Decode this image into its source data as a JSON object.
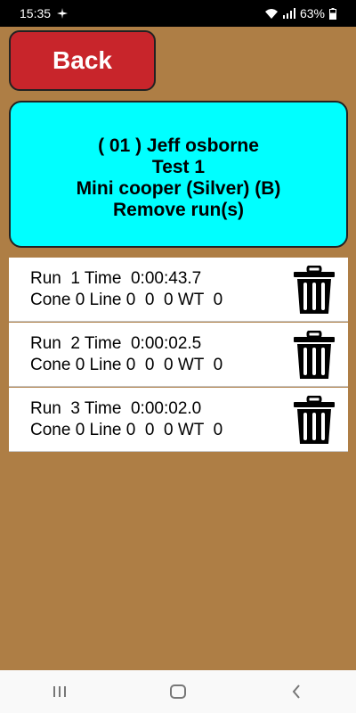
{
  "status_bar": {
    "time": "15:35",
    "battery": "63%"
  },
  "back_button": {
    "label": "Back"
  },
  "info": {
    "driver": "( 01 ) Jeff osborne",
    "test": "Test  1",
    "car": "Mini cooper (Silver) (B)",
    "action": "Remove run(s)"
  },
  "runs": [
    {
      "line1": "Run  1 Time  0:00:43.7",
      "line2": "Cone 0 Line 0  0  0 WT  0"
    },
    {
      "line1": "Run  2 Time  0:00:02.5",
      "line2": "Cone 0 Line 0  0  0 WT  0"
    },
    {
      "line1": "Run  3 Time  0:00:02.0",
      "line2": "Cone 0 Line 0  0  0 WT  0"
    }
  ],
  "colors": {
    "background": "#ae7e45",
    "back_button": "#c8252b",
    "info_card": "#00ffff"
  },
  "icons": {
    "status_left": "airplane-icon",
    "status_right": [
      "wifi-icon",
      "signal-icon",
      "battery-icon"
    ],
    "row_action": "trash-icon",
    "nav": [
      "recents-icon",
      "home-icon",
      "back-icon"
    ]
  }
}
